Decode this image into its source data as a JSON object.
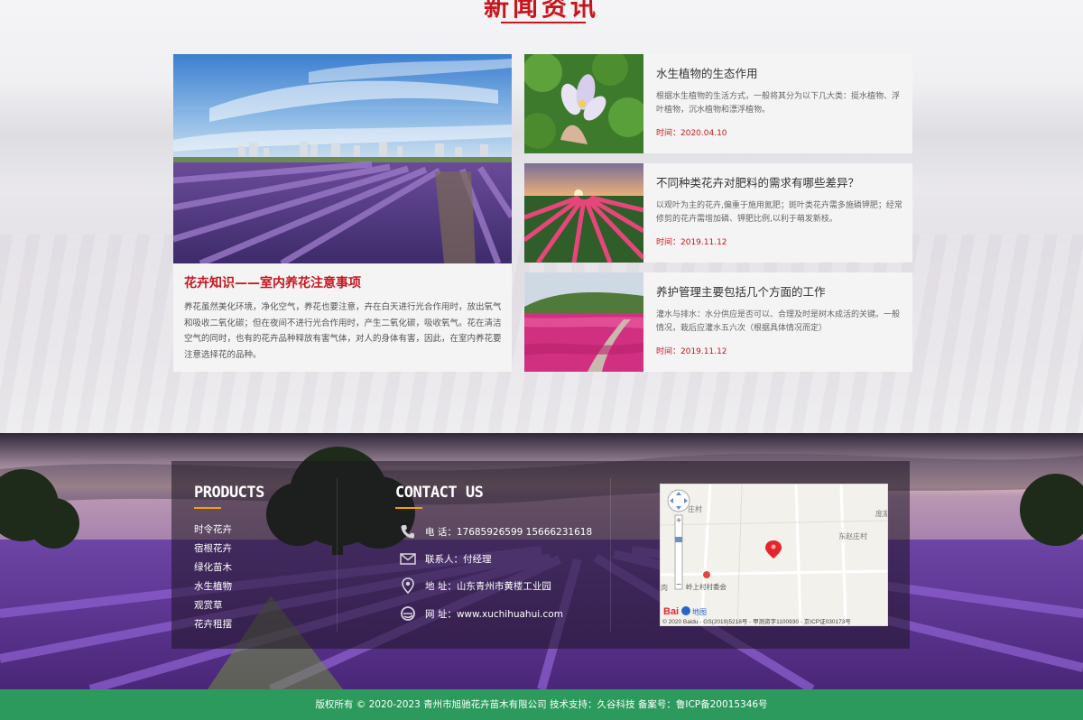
{
  "news": {
    "section_title": "新闻资讯",
    "feature": {
      "title": "花卉知识——室内养花注意事项",
      "text": "养花虽然美化环境，净化空气，养花也要注意，卉在白天进行光合作用时，放出氧气和吸收二氧化碳；但在夜间不进行光合作用时，产生二氧化碳，吸收氧气。花在清洁空气的同时，也有的花卉品种释放有害气体，对人的身体有害，因此，在室内养花要注意选择花的品种。"
    },
    "items": [
      {
        "title": "水生植物的生态作用",
        "desc": "根据水生植物的生活方式，一般将其分为以下几大类：挺水植物、浮叶植物，沉水植物和漂浮植物。",
        "date": "时间：2020.04.10"
      },
      {
        "title": "不同种类花卉对肥料的需求有哪些差异？",
        "desc": "以观叶为主的花卉,偏重于施用氮肥；斑叶类花卉需多施磷钾肥；经常修剪的花卉需增加磷、钾肥比例,以利于萌发新枝。",
        "date": "时间：2019.11.12"
      },
      {
        "title": "养护管理主要包括几个方面的工作",
        "desc": "灌水与排水：水分供应是否可以、合理及时是树木成活的关键。一般情况，栽后应灌水五六次（根据具体情况而定）",
        "date": "时间：2019.11.12"
      }
    ]
  },
  "footer": {
    "products_heading": "PRODUCTS",
    "products": [
      "时令花卉",
      "宿根花卉",
      "绿化苗木",
      "水生植物",
      "观赏草",
      "花卉租摆"
    ],
    "contact_heading": "CONTACT US",
    "contact": [
      {
        "icon": "phone-icon",
        "text": "电    话：17685926599 15666231618"
      },
      {
        "icon": "mail-icon",
        "text": "联系人：付经理"
      },
      {
        "icon": "location-icon",
        "text": "地    址：山东青州市黄楼工业园"
      },
      {
        "icon": "web-icon",
        "text": "网    址：www.xuchihuahui.com"
      }
    ],
    "map": {
      "label_top_right": "庞家",
      "label_dongzhao": "东赵庄村",
      "label_village": "岭上村村委会",
      "label_left1": "庄村",
      "label_left2": "肉",
      "baidu_logo_text": "Bai",
      "baidu_logo_suffix": "地图",
      "copyright": "© 2020 Baidu - GS(2019)5218号 - 甲测资字1100930 - 京ICP证030173号",
      "zoom_in": "+",
      "zoom_out": "−"
    },
    "copyright": "版权所有 © 2020-2023 青州市旭驰花卉苗木有限公司 技术支持：久谷科技    备案号：鲁ICP备20015346号"
  },
  "colors": {
    "accent_red": "#c8161d",
    "footer_green": "#2c9a5c",
    "heading_bar_orange": "#f1a100"
  }
}
